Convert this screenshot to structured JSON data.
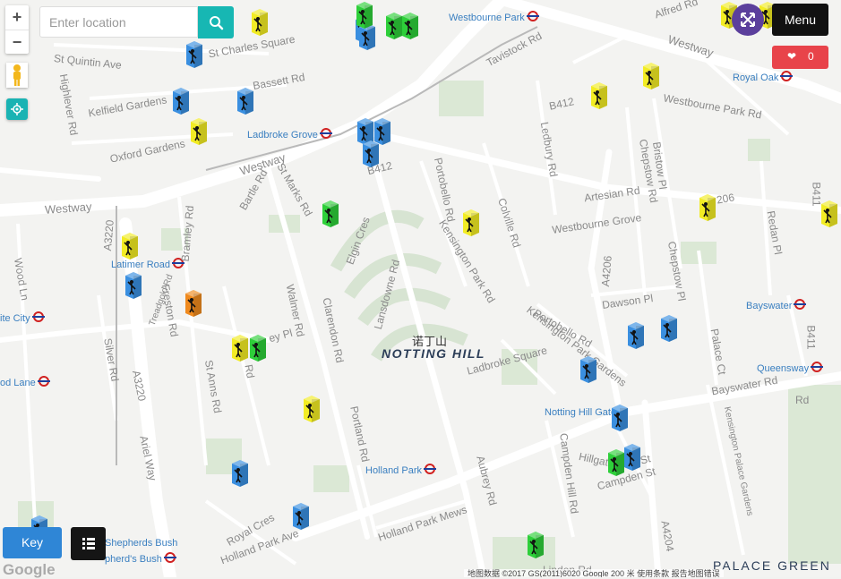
{
  "search": {
    "placeholder": "Enter location"
  },
  "controls": {
    "zoom_in": "+",
    "zoom_out": "−"
  },
  "menu": {
    "label": "Menu"
  },
  "likes": {
    "count": "0"
  },
  "key": {
    "label": "Key"
  },
  "google": {
    "logo": "Google"
  },
  "attribution": "地图数据 ©2017 GS(2011)6020 Google   200 米   使用条款   报告地图错误",
  "area": {
    "chinese": "诺丁山",
    "name": "NOTTING HILL"
  },
  "stations": [
    {
      "name": "Westbourne Park"
    },
    {
      "name": "Royal Oak"
    },
    {
      "name": "Ladbroke Grove"
    },
    {
      "name": "Latimer Road"
    },
    {
      "name": "ite City"
    },
    {
      "name": "od Lane"
    },
    {
      "name": "Bayswater"
    },
    {
      "name": "Queensway"
    },
    {
      "name": "Notting Hill Gate"
    },
    {
      "name": "Holland Park"
    },
    {
      "name": "Shepherds Bush"
    },
    {
      "name": "pherd's Bush"
    }
  ],
  "streets": [
    {
      "name": "St Quintin Ave"
    },
    {
      "name": "St Charles Square"
    },
    {
      "name": "Bassett Rd"
    },
    {
      "name": "Highlever Rd"
    },
    {
      "name": "Kelfield Gardens"
    },
    {
      "name": "Oxford Gardens"
    },
    {
      "name": "Westway"
    },
    {
      "name": "Westway"
    },
    {
      "name": "Westway"
    },
    {
      "name": "Tavistock Rd"
    },
    {
      "name": "Alfred Rd"
    },
    {
      "name": "B412"
    },
    {
      "name": "B412"
    },
    {
      "name": "Ledbury Rd"
    },
    {
      "name": "Chepstow Rd"
    },
    {
      "name": "Bristow Pl"
    },
    {
      "name": "Artesian Rd"
    },
    {
      "name": "Westbourne Grove"
    },
    {
      "name": "Westbourne Park Rd"
    },
    {
      "name": "Portobello Rd"
    },
    {
      "name": "Colville Rd"
    },
    {
      "name": "Kensington Park Rd"
    },
    {
      "name": "Elgin Cres"
    },
    {
      "name": "Lansdowne Rd"
    },
    {
      "name": "Clarendon Rd"
    },
    {
      "name": "Walmer Rd"
    },
    {
      "name": "Bramley Rd"
    },
    {
      "name": "A3220"
    },
    {
      "name": "A3220"
    },
    {
      "name": "Wood Ln"
    },
    {
      "name": "Freston Rd"
    },
    {
      "name": "Silver Rd"
    },
    {
      "name": "St Anns Rd"
    },
    {
      "name": "Portland Rd"
    },
    {
      "name": "Ladbroke Square"
    },
    {
      "name": "Kensington Park Gardens"
    },
    {
      "name": "Portobello Rd"
    },
    {
      "name": "Dawson Pl"
    },
    {
      "name": "Chepstow Pl"
    },
    {
      "name": "A4206"
    },
    {
      "name": "Palace Ct"
    },
    {
      "name": "Bayswater Rd"
    },
    {
      "name": "Kensington Palace Gardens"
    },
    {
      "name": "Campden Hill Rd"
    },
    {
      "name": "Aubrey Rd"
    },
    {
      "name": "Hillgate"
    },
    {
      "name": "Peel St"
    },
    {
      "name": "Campden St"
    },
    {
      "name": "A4204"
    },
    {
      "name": "Holland Park Mews"
    },
    {
      "name": "Holland Park Ave"
    },
    {
      "name": "Royal Cres"
    },
    {
      "name": "Ariel Way"
    },
    {
      "name": "Redan Pl"
    },
    {
      "name": "B411"
    },
    {
      "name": "B411"
    },
    {
      "name": "206"
    },
    {
      "name": "St Marks Rd"
    },
    {
      "name": "Bartle Rd"
    },
    {
      "name": "Treadgold Rd"
    },
    {
      "name": "Rd"
    },
    {
      "name": "ey Pl"
    },
    {
      "name": "Rd"
    },
    {
      "name": "Linden Rd"
    }
  ],
  "palace_green": "PALACE GREEN",
  "markers": [
    {
      "color": "#3a8fe0"
    },
    {
      "color": "#3a8fe0"
    },
    {
      "color": "#3a8fe0"
    },
    {
      "color": "#3a8fe0"
    },
    {
      "color": "#3a8fe0"
    },
    {
      "color": "#3a8fe0"
    },
    {
      "color": "#3a8fe0"
    },
    {
      "color": "#3a8fe0"
    },
    {
      "color": "#3a8fe0"
    },
    {
      "color": "#3a8fe0"
    },
    {
      "color": "#3a8fe0"
    },
    {
      "color": "#3a8fe0"
    },
    {
      "color": "#3a8fe0"
    },
    {
      "color": "#3a8fe0"
    },
    {
      "color": "#3a8fe0"
    },
    {
      "color": "#3a8fe0"
    },
    {
      "color": "#3a8fe0"
    },
    {
      "color": "#f2ec24"
    },
    {
      "color": "#f2ec24"
    },
    {
      "color": "#f2ec24"
    },
    {
      "color": "#f2ec24"
    },
    {
      "color": "#f2ec24"
    },
    {
      "color": "#f2ec24"
    },
    {
      "color": "#f2ec24"
    },
    {
      "color": "#f2ec24"
    },
    {
      "color": "#f2ec24"
    },
    {
      "color": "#f2ec24"
    },
    {
      "color": "#f2ec24"
    },
    {
      "color": "#f2ec24"
    },
    {
      "color": "#2ecf3a"
    },
    {
      "color": "#2ecf3a"
    },
    {
      "color": "#2ecf3a"
    },
    {
      "color": "#2ecf3a"
    },
    {
      "color": "#2ecf3a"
    },
    {
      "color": "#2ecf3a"
    },
    {
      "color": "#2ecf3a"
    },
    {
      "color": "#f08a1e"
    }
  ]
}
